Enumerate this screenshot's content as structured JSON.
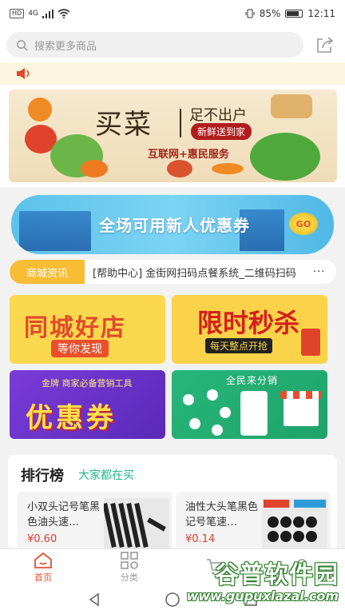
{
  "status_bar": {
    "hd_badge": "HD",
    "network": "4G",
    "battery": "85%",
    "battery_level": 0.85,
    "time": "12:11"
  },
  "search": {
    "placeholder": "搜索更多商品"
  },
  "banner": {
    "title": "买菜",
    "subtitle": "足不出户",
    "pill": "新鲜送到家",
    "tagline": "互联网+惠民服务"
  },
  "coupon_banner": {
    "text": "全场可用新人优惠券",
    "coin_text": "GO"
  },
  "news": {
    "label": "商城资讯",
    "headline": "[帮助中心] 金街网扫码点餐系统_二维码扫码",
    "more": "···"
  },
  "tiles": {
    "tile1": {
      "title": "同城好店",
      "subtitle": "等你发现"
    },
    "tile2": {
      "title": "限时秒杀",
      "subtitle": "每天整点开抢"
    },
    "tile3": {
      "badge": "金牌 商家必备营销工具",
      "title": "优惠券"
    },
    "tile4": {
      "title": "全民来分销"
    }
  },
  "ranking": {
    "title": "排行榜",
    "subtitle": "大家都在买",
    "products": [
      {
        "name": "小双头记号笔黑色油头速…",
        "price": "¥0.60"
      },
      {
        "name": "油性大头笔黑色记号笔速…",
        "price": "¥0.14"
      }
    ]
  },
  "tabbar": {
    "tabs": [
      {
        "label": "首页",
        "icon": "home-icon",
        "active": true
      },
      {
        "label": "分类",
        "icon": "grid-icon",
        "active": false
      },
      {
        "label": "",
        "icon": "cart-icon",
        "active": false
      },
      {
        "label": "",
        "icon": "user-icon",
        "active": false
      }
    ]
  },
  "watermark": {
    "title": "谷普软件园",
    "url": "www.gupuxlazal.com"
  },
  "colors": {
    "accent": "#e94f2c",
    "green": "#21b48a",
    "notice_bg": "#fdf5e0",
    "news_label": "#f6bd35"
  }
}
